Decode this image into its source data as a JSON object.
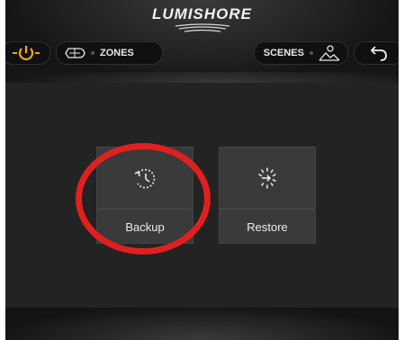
{
  "header": {
    "brand": "LUMISHORE",
    "zones_label": "ZONES",
    "scenes_label": "SCENES"
  },
  "icons": {
    "power": "power-icon",
    "zones": "boat-icon",
    "scenes": "mountain-icon",
    "back": "back-arrow-icon",
    "backup": "backup-icon",
    "restore": "restore-icon"
  },
  "colors": {
    "accent": "#f0a814",
    "highlight": "#e02020",
    "tile": "#3a3a3a"
  },
  "main": {
    "backup_label": "Backup",
    "restore_label": "Restore"
  }
}
